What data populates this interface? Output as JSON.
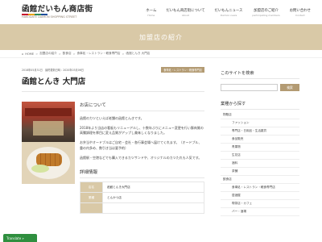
{
  "header": {
    "logo_title": "函館だいもん商店街",
    "logo_sub": "HAKODATE DAIMON SHOPPING STREET",
    "logo_bar_colors": [
      "#c8102e",
      "#e8a317",
      "#2e8b57",
      "#1f4e9c"
    ],
    "nav": [
      {
        "jp": "ホーム",
        "en": "Home"
      },
      {
        "jp": "だいもん商店街について",
        "en": "About"
      },
      {
        "jp": "だいもんニュース",
        "en": "Daimon news"
      },
      {
        "jp": "加盟店のご紹介",
        "en": "participating members"
      },
      {
        "jp": "お問い合わせ",
        "en": "Contact"
      }
    ]
  },
  "banner": {
    "title": "加盟店の紹介",
    "color": "#d9c9a7"
  },
  "breadcrumb": [
    "HOME",
    "加盟店の紹介",
    "飲食店",
    "食事処・レストラン・軽食専門店",
    "函館とんき 大門店"
  ],
  "post": {
    "date": "2018年05月31日　最終更新日時 : 2020年03月06日",
    "tags": [
      "食事処・レストラン・軽食専門店"
    ],
    "title": "函館とんき 大門店",
    "section": "お店について",
    "paragraphs": [
      "函館のカツといえば老舗の函館とんきです。",
      "2018年より当店の看板もリニューアルし、十数年ぶりにメニュー変更を行い豚肉質の高騰調理を厚目に変え品質がアップし美味しくなりました。",
      "お弁当やオードブルはご自宅・会社・各行事会場へ届けてくれます。（オードブル、重の内多め、数引き当は要予約）",
      "函館駅・空港などでも購入できるカツサンドや、オリジナルのカツたれも人気です。"
    ],
    "detail_head": "詳細情報",
    "details": [
      {
        "key": "店名",
        "value": "函館とんき大門店"
      },
      {
        "key": "業種",
        "value": "とんかつ店"
      },
      {
        "key": "",
        "value": ""
      }
    ]
  },
  "sidebar": {
    "search_title": "このサイトを検索",
    "search_placeholder": "",
    "search_button": "検索",
    "category_title": "業種から探す",
    "categories": [
      {
        "label": "物販店",
        "level": 1
      },
      {
        "label": "ファッション",
        "level": 2
      },
      {
        "label": "専門店・日用品・生活雑貨",
        "level": 2
      },
      {
        "label": "食品販売",
        "level": 2
      },
      {
        "label": "青果物",
        "level": 2
      },
      {
        "label": "生花店",
        "level": 2
      },
      {
        "label": "酒料",
        "level": 2
      },
      {
        "label": "茶舗",
        "level": 2
      },
      {
        "label": "飲食店",
        "level": 1
      },
      {
        "label": "食事処・レストラン・軽食専門店",
        "level": 2
      },
      {
        "label": "居酒屋",
        "level": 2
      },
      {
        "label": "喫茶店・カフェ",
        "level": 2
      },
      {
        "label": "バー・酒場",
        "level": 2
      }
    ]
  },
  "translate_label": "Translate »"
}
